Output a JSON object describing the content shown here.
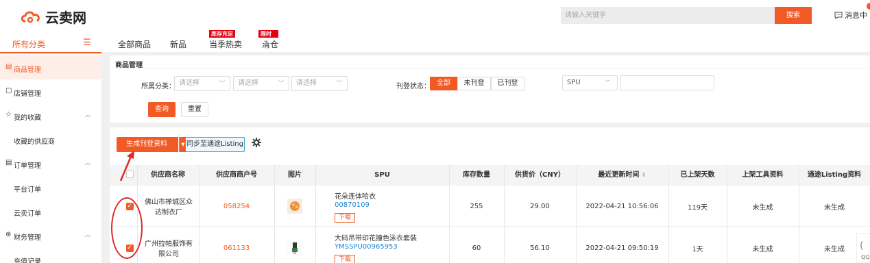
{
  "header": {
    "logo_text": "云卖网",
    "search_placeholder": "请输入关键字",
    "search_button": "搜索",
    "messages_label": "消息中"
  },
  "nav": {
    "all_categories": "所有分类",
    "items": [
      {
        "label": "全部商品",
        "tag": ""
      },
      {
        "label": "新品",
        "tag": ""
      },
      {
        "label": "当季热卖",
        "tag": "库存充足"
      },
      {
        "label": "清仓",
        "tag": "限时9.9"
      }
    ]
  },
  "sidebar": {
    "items": [
      {
        "label": "商品管理",
        "icon": "product-icon"
      },
      {
        "label": "店铺管理",
        "icon": "shop-icon"
      },
      {
        "label": "我的收藏",
        "icon": "star-icon"
      },
      {
        "label": "收藏的供应商",
        "icon": ""
      },
      {
        "label": "订单管理",
        "icon": "order-icon"
      },
      {
        "label": "平台订单",
        "icon": ""
      },
      {
        "label": "云卖订单",
        "icon": ""
      },
      {
        "label": "财务管理",
        "icon": "finance-icon"
      },
      {
        "label": "充值记录",
        "icon": ""
      }
    ]
  },
  "filter": {
    "title": "商品管理",
    "category_label": "所属分类：",
    "select_placeholder": "请选择",
    "status_label": "刊登状态：",
    "status_options": [
      "全部",
      "未刊登",
      "已刊登"
    ],
    "spu_select": "SPU",
    "query_button": "查询",
    "reset_button": "重置"
  },
  "actions": {
    "generate_button": "生成刊登资料",
    "sync_button": "同步至通途Listing"
  },
  "table": {
    "headers": [
      "供应商名称",
      "供应商商户号",
      "图片",
      "SPU",
      "库存数量",
      "供货价（CNY）",
      "最近更新时间",
      "已上架天数",
      "上架工具资料",
      "通途Listing资料"
    ],
    "rows": [
      {
        "supplier": "佛山市禅城区众达制衣厂",
        "merchant_no": "058254",
        "spu_name": "花朵连体哈衣",
        "spu_code": "00870109",
        "download": "下载",
        "stock": "255",
        "price": "29.00",
        "updated": "2022-04-21 10:56:06",
        "days": "119天",
        "tool_data": "未生成",
        "listing_data": "未生成",
        "checked": true
      },
      {
        "supplier": "广州拉帕服饰有限公司",
        "merchant_no": "061133",
        "spu_name": "大码吊带印花撞色泳衣套装",
        "spu_code": "YMSSPU00965953",
        "download": "下载",
        "stock": "60",
        "price": "56.10",
        "updated": "2022-04-21 09:50:19",
        "days": "1天",
        "tool_data": "未生成",
        "listing_data": "未生成",
        "checked": true
      }
    ]
  },
  "qq_label": "QQ",
  "colors": {
    "accent": "#f15a24",
    "link": "#1e88d2",
    "annotation": "#e0282b"
  }
}
